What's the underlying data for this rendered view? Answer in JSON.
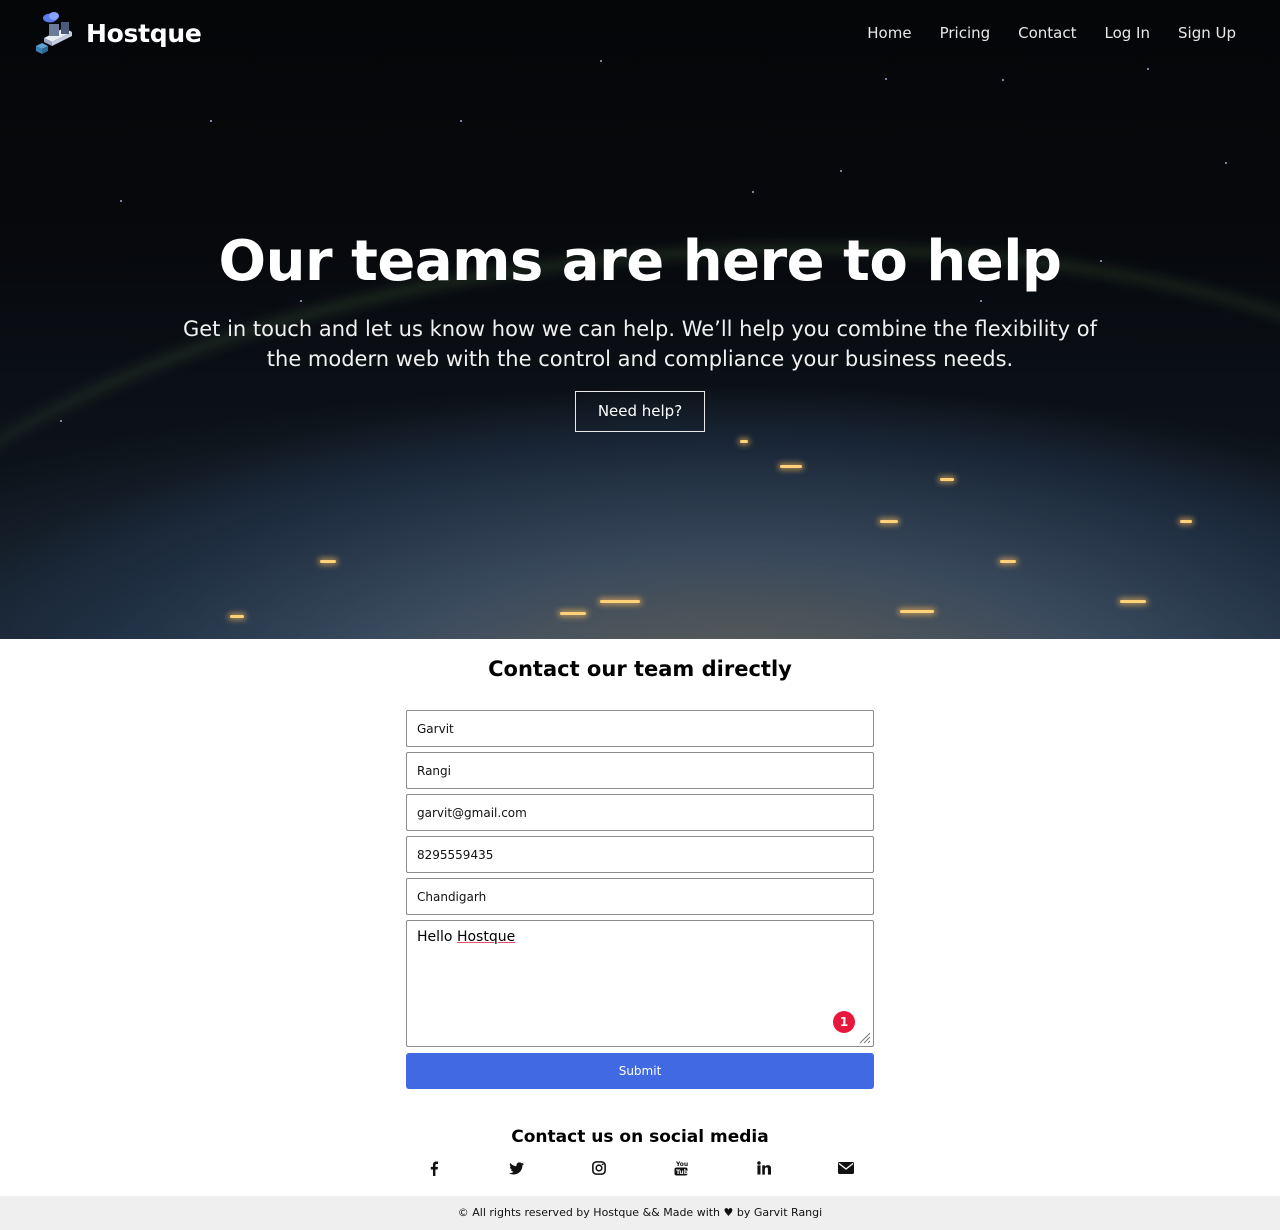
{
  "brand": {
    "name": "Hostque"
  },
  "nav": {
    "items": [
      {
        "label": "Home"
      },
      {
        "label": "Pricing"
      },
      {
        "label": "Contact"
      },
      {
        "label": "Log In"
      },
      {
        "label": "Sign Up"
      }
    ]
  },
  "hero": {
    "title": "Our teams are here to help",
    "subtitle": "Get in touch and let us know how we can help. We’ll help you combine the flexibility of the modern web with the control and compliance your business needs.",
    "button_label": "Need help?"
  },
  "contact": {
    "title": "Contact our team directly",
    "fields": {
      "first_name": "Garvit",
      "last_name": "Rangi",
      "email": "garvit@gmail.com",
      "phone": "8295559435",
      "city": "Chandigarh"
    },
    "message": {
      "prefix": "Hello ",
      "misspelled": "Hostque"
    },
    "badge_count": "1",
    "submit_label": "Submit"
  },
  "social": {
    "title": "Contact us on social media",
    "icons": [
      "facebook-icon",
      "twitter-icon",
      "instagram-icon",
      "youtube-icon",
      "linkedin-icon",
      "envelope-icon"
    ]
  },
  "footer": {
    "text": "© All rights reserved by Hostque && Made with ♥ by Garvit Rangi"
  },
  "colors": {
    "accent": "#4169e1",
    "badge": "#e8173c",
    "footer_bg": "#efefef"
  }
}
